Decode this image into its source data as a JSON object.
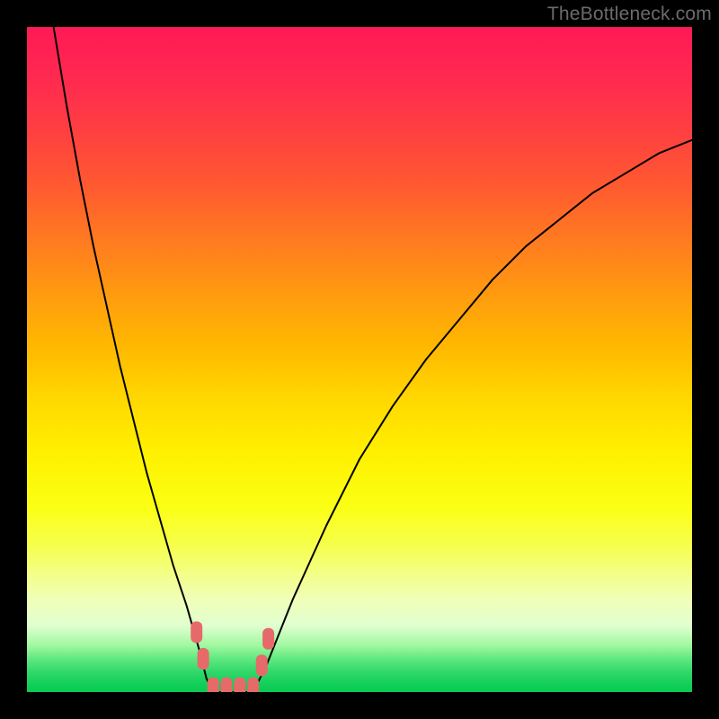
{
  "watermark": "TheBottleneck.com",
  "colors": {
    "background": "#000000",
    "curve_stroke": "#000000",
    "marker_fill": "#e76a6a",
    "marker_stroke": "#d85a5a",
    "gradient_top": "#ff1a55",
    "gradient_bottom": "#0acb53"
  },
  "chart_data": {
    "type": "line",
    "title": "",
    "xlabel": "",
    "ylabel": "",
    "xlim": [
      0,
      100
    ],
    "ylim": [
      0,
      100
    ],
    "note": "A V-shaped bottleneck curve over a vertical red→green gradient. Values are estimated from pixel positions; axes are unlabeled. y≈0 is the green bottom (optimal), y≈100 is the red top.",
    "series": [
      {
        "name": "left-branch",
        "x": [
          4,
          6,
          8,
          10,
          12,
          14,
          16,
          18,
          20,
          22,
          24,
          26,
          27,
          28
        ],
        "values": [
          100,
          88,
          77,
          67,
          58,
          49,
          41,
          33,
          26,
          19,
          13,
          6,
          2,
          0
        ]
      },
      {
        "name": "floor",
        "x": [
          28,
          29,
          30,
          31,
          32,
          33,
          34
        ],
        "values": [
          0,
          0,
          0,
          0,
          0,
          0,
          0
        ]
      },
      {
        "name": "right-branch",
        "x": [
          34,
          36,
          40,
          45,
          50,
          55,
          60,
          65,
          70,
          75,
          80,
          85,
          90,
          95,
          100
        ],
        "values": [
          0,
          4,
          14,
          25,
          35,
          43,
          50,
          56,
          62,
          67,
          71,
          75,
          78,
          81,
          83
        ]
      }
    ],
    "markers": {
      "name": "highlight-band",
      "points": [
        {
          "x": 25.5,
          "y": 9
        },
        {
          "x": 26.5,
          "y": 5
        },
        {
          "x": 28.0,
          "y": 0.6
        },
        {
          "x": 30.0,
          "y": 0.6
        },
        {
          "x": 32.0,
          "y": 0.6
        },
        {
          "x": 34.0,
          "y": 0.6
        },
        {
          "x": 35.3,
          "y": 4
        },
        {
          "x": 36.3,
          "y": 8
        }
      ]
    }
  }
}
